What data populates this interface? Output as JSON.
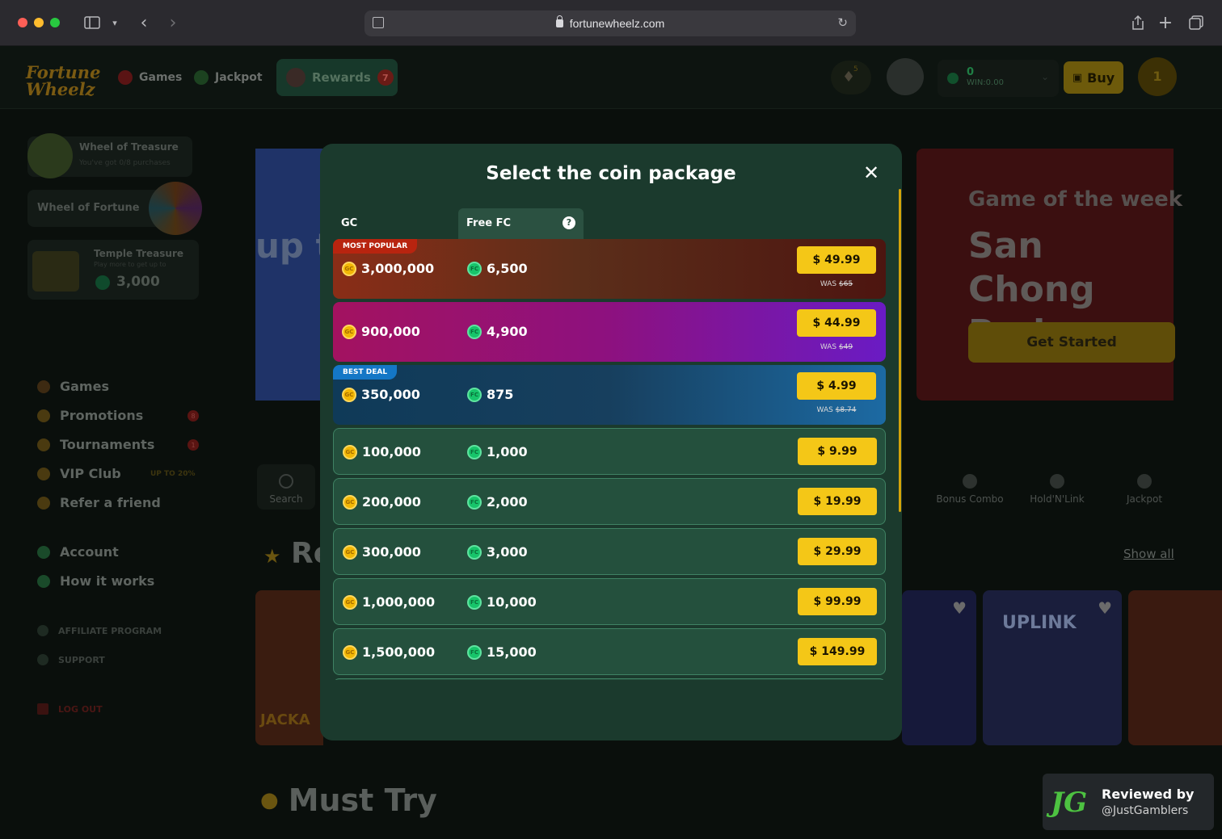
{
  "browser": {
    "url": "fortunewheelz.com"
  },
  "site": {
    "logo_line1": "Fortune",
    "logo_line2": "Wheelz",
    "nav": {
      "games": "Games",
      "jackpot": "Jackpot",
      "rewards": "Rewards",
      "rewards_badge": "7"
    },
    "notif_badge": "5",
    "wallet": {
      "gc_value": "0",
      "win_label": "WIN:0.00"
    },
    "buy_label": "Buy",
    "level": "1"
  },
  "sidebar": {
    "wheel_of_treasure": {
      "title": "Wheel of Treasure",
      "sub": "You've got 0/8 purchases"
    },
    "wheel_of_fortune": "Wheel of Fortune",
    "temple_treasure": {
      "title": "Temple Treasure",
      "sub": "Play more to get up to",
      "value": "3,000"
    },
    "menu": [
      {
        "label": "Games",
        "badge": ""
      },
      {
        "label": "Promotions",
        "badge": "8"
      },
      {
        "label": "Tournaments",
        "badge": "1"
      },
      {
        "label": "VIP Club",
        "badge": ""
      },
      {
        "label": "Refer a friend",
        "badge": ""
      }
    ],
    "vip_tag": "UP TO 20%",
    "account": "Account",
    "how_it_works": "How it works",
    "affiliate": "AFFILIATE PROGRAM",
    "support": "SUPPORT",
    "logout": "LOG OUT"
  },
  "hero": {
    "blue_text": "up t",
    "game_of_week_label": "Game of the week",
    "game_of_week_title": "San Chong Red",
    "get_started": "Get Started"
  },
  "categories": {
    "search": "Search",
    "bonus_combo": "Bonus Combo",
    "hold_n_link": "Hold'N'Link",
    "jackpot": "Jackpot"
  },
  "recent": {
    "heading": "Re",
    "show_all": "Show all"
  },
  "tiles": {
    "jackal": "JACKA",
    "uplink": "UPLINK"
  },
  "must_try": "Must Try",
  "modal": {
    "title": "Select the coin package",
    "col_gc": "GC",
    "col_fc": "Free FC",
    "help": "?",
    "coin_gc": "GC",
    "coin_fc": "FC",
    "packages": [
      {
        "tag": "MOST POPULAR",
        "gc": "3,000,000",
        "fc": "6,500",
        "price": "$ 49.99",
        "was_label": "WAS",
        "was": "$65"
      },
      {
        "tag": "",
        "gc": "900,000",
        "fc": "4,900",
        "price": "$ 44.99",
        "was_label": "WAS",
        "was": "$49"
      },
      {
        "tag": "BEST DEAL",
        "gc": "350,000",
        "fc": "875",
        "price": "$ 4.99",
        "was_label": "WAS",
        "was": "$8.74"
      },
      {
        "tag": "",
        "gc": "100,000",
        "fc": "1,000",
        "price": "$ 9.99",
        "was_label": "",
        "was": ""
      },
      {
        "tag": "",
        "gc": "200,000",
        "fc": "2,000",
        "price": "$ 19.99",
        "was_label": "",
        "was": ""
      },
      {
        "tag": "",
        "gc": "300,000",
        "fc": "3,000",
        "price": "$ 29.99",
        "was_label": "",
        "was": ""
      },
      {
        "tag": "",
        "gc": "1,000,000",
        "fc": "10,000",
        "price": "$ 99.99",
        "was_label": "",
        "was": ""
      },
      {
        "tag": "",
        "gc": "1,500,000",
        "fc": "15,000",
        "price": "$ 149.99",
        "was_label": "",
        "was": ""
      }
    ]
  },
  "review_badge": {
    "logo": "JG",
    "line1": "Reviewed by",
    "line2": "@JustGamblers"
  },
  "colors": {
    "modal_bg": "#1b3a2d",
    "price_button": "#f4c717",
    "most_popular_tag": "#b8240f",
    "best_deal_tag": "#1477c6",
    "gc_coin": "#f2b705",
    "fc_coin": "#17c46a"
  }
}
